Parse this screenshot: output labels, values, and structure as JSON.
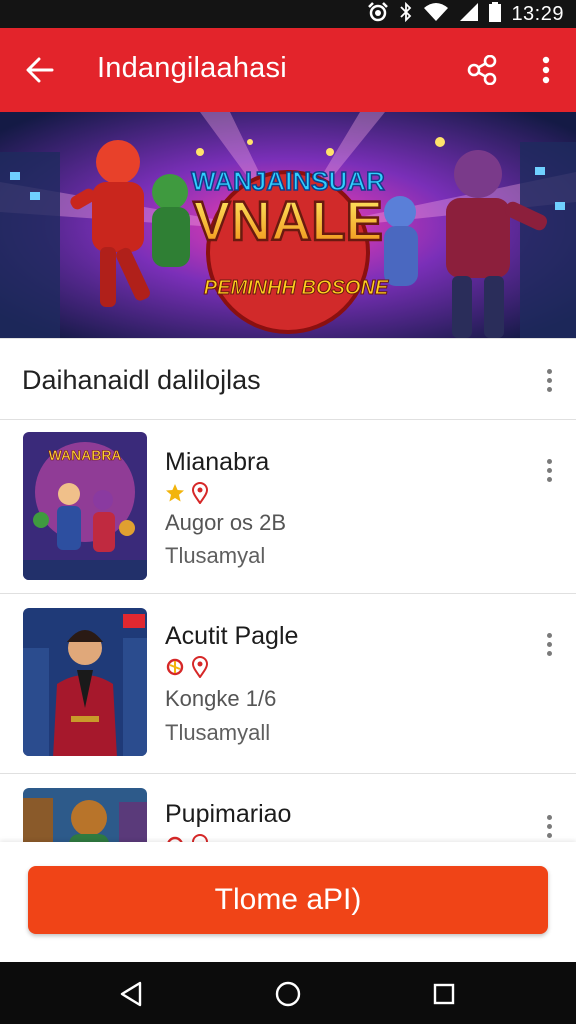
{
  "status_bar": {
    "time": "13:29",
    "icons": [
      "alarm-icon",
      "bluetooth-icon",
      "wifi-icon",
      "signal-icon",
      "battery-icon"
    ]
  },
  "app_bar": {
    "title": "Indangilaahasi",
    "back_icon": "arrow-left-icon",
    "share_icon": "share-icon",
    "more_icon": "more-vertical-icon"
  },
  "banner": {
    "headline_top": "WANJAINSUAR",
    "headline_main": "VNALE",
    "tagline": "PEMINHH BOSONE"
  },
  "section": {
    "title": "Daihanaidl dalilojlas"
  },
  "items": [
    {
      "title": "Mianabra",
      "meta": "Augor os 2B",
      "sub": "Tlusamyal",
      "icons": [
        "star-icon",
        "location-pin-icon"
      ],
      "thumb_text": "WANABRA"
    },
    {
      "title": "Acutit Pagle",
      "meta": "Kongke 1/6",
      "sub": "Tlusamyall",
      "icons": [
        "badge-icon",
        "location-pin-icon"
      ]
    },
    {
      "title": "Pupimariao",
      "meta": "",
      "sub": "",
      "icons": [
        "badge-icon",
        "location-pin-icon"
      ]
    }
  ],
  "cta": {
    "label": "Tlome aPI)"
  },
  "colors": {
    "app_bar": "#e3242b",
    "cta": "#f04417",
    "status_bar": "#141414",
    "nav_bar": "#0c0c0c"
  },
  "nav": {
    "icons": [
      "back-triangle-icon",
      "home-circle-icon",
      "recents-square-icon"
    ]
  }
}
